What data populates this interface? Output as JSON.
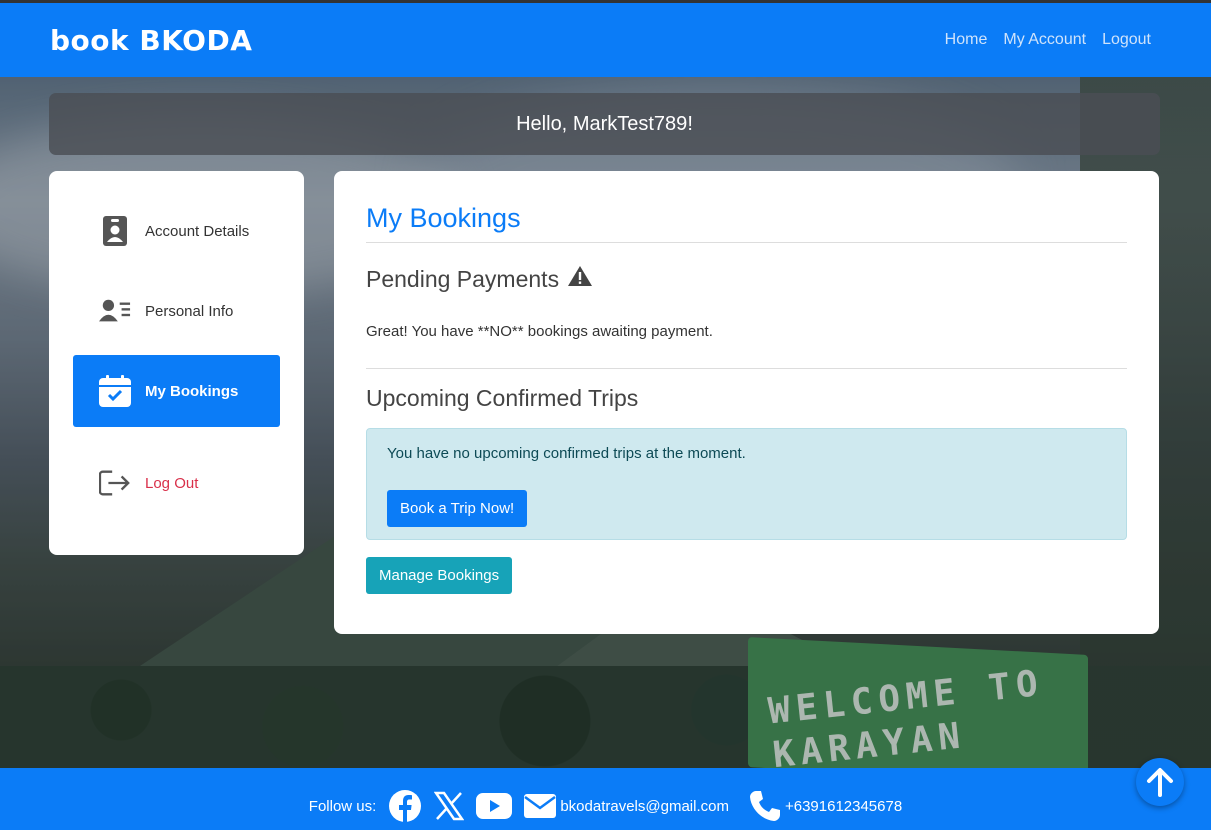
{
  "header": {
    "brand": "book BKODA",
    "nav": [
      {
        "label": "Home"
      },
      {
        "label": "My Account"
      },
      {
        "label": "Logout"
      }
    ]
  },
  "greeting": {
    "prefix": "Hello, ",
    "username": "MarkTest789",
    "suffix": "!"
  },
  "sidebar": {
    "items": [
      {
        "label": "Account Details",
        "icon": "id-badge-icon"
      },
      {
        "label": "Personal Info",
        "icon": "address-card-icon"
      },
      {
        "label": "My Bookings",
        "icon": "calendar-check-icon",
        "active": true
      },
      {
        "label": "Log Out",
        "icon": "logout-icon"
      }
    ]
  },
  "main": {
    "title": "My Bookings",
    "pending": {
      "heading": "Pending Payments",
      "icon": "warning-icon",
      "message": "Great! You have **NO** bookings awaiting payment."
    },
    "upcoming": {
      "heading": "Upcoming Confirmed Trips",
      "alert_text": "You have no upcoming confirmed trips at the moment.",
      "book_button": "Book a Trip Now!"
    },
    "manage_button": "Manage Bookings"
  },
  "footer": {
    "follow_label": "Follow us:",
    "email": "bkodatravels@gmail.com",
    "phone": "+6391612345678"
  },
  "colors": {
    "primary": "#0b7cf7",
    "info": "#17a3b8",
    "danger": "#d9304a",
    "alert_bg": "#cfe9ef"
  }
}
